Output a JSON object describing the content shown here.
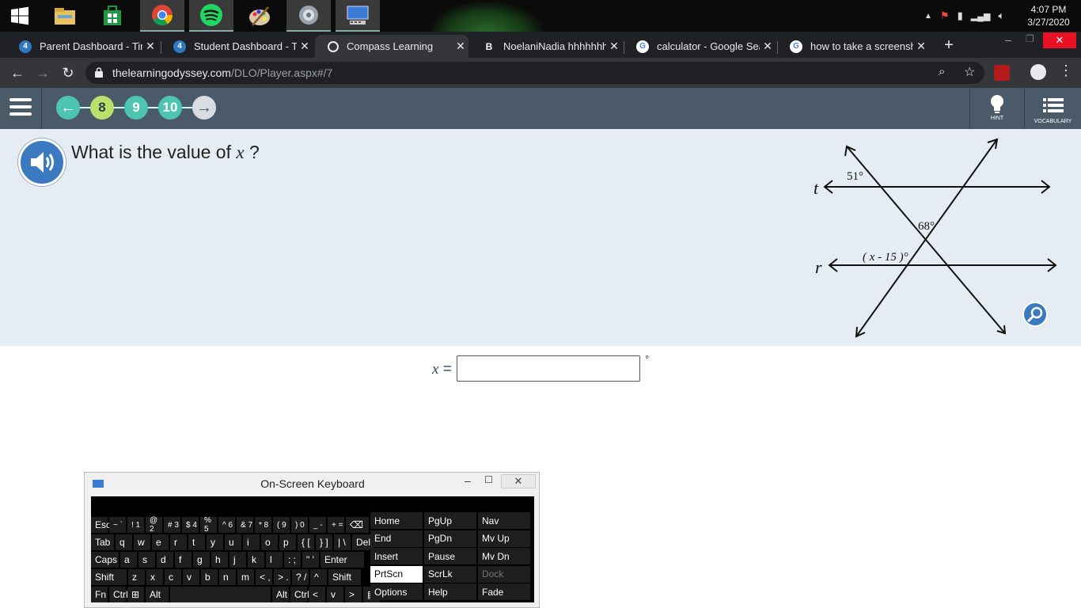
{
  "taskbar": {
    "apps": [
      "file-explorer",
      "microsoft-store",
      "chrome",
      "spotify",
      "paint",
      "volume-app",
      "on-screen-keyboard-app"
    ],
    "time": "4:07 PM",
    "date": "3/27/2020"
  },
  "tabs": [
    {
      "title": "Parent Dashboard - Time",
      "active": false
    },
    {
      "title": "Student Dashboard - Tim",
      "active": false
    },
    {
      "title": "Compass Learning",
      "active": true
    },
    {
      "title": "NoelaniNadia hhhhhhhh",
      "active": false
    },
    {
      "title": "calculator - Google Sear",
      "active": false
    },
    {
      "title": "how to take a screensho",
      "active": false
    }
  ],
  "address": {
    "url_host": "thelearningodyssey.com",
    "url_path": "/DLO/Player.aspx#/7"
  },
  "app": {
    "questions": [
      "8",
      "9",
      "10"
    ],
    "hint_label": "HINT",
    "vocab_label": "VOCABULARY"
  },
  "question": {
    "prefix": "What is the value of ",
    "var": "x",
    "suffix": " ?"
  },
  "diagram": {
    "line_t": "t",
    "line_r": "r",
    "angle_top": "51°",
    "angle_mid": "68°",
    "angle_expr": "( x - 15 )°"
  },
  "answer": {
    "label_var": "x",
    "label_eq": " =",
    "value": "",
    "unit": "°"
  },
  "osk": {
    "title": "On-Screen Keyboard",
    "rows": [
      [
        "Esc",
        "~ `",
        "! 1",
        "@ 2",
        "# 3",
        "$ 4",
        "% 5",
        "^ 6",
        "& 7",
        "* 8",
        "( 9",
        ") 0",
        "_ -",
        "+ =",
        "⌫"
      ],
      [
        "Tab",
        "q",
        "w",
        "e",
        "r",
        "t",
        "y",
        "u",
        "i",
        "o",
        "p",
        "{ [",
        "} ]",
        "| \\",
        "Del"
      ],
      [
        "Caps",
        "a",
        "s",
        "d",
        "f",
        "g",
        "h",
        "j",
        "k",
        "l",
        ": ;",
        "\" '",
        "Enter"
      ],
      [
        "Shift",
        "z",
        "x",
        "c",
        "v",
        "b",
        "n",
        "m",
        "< ,",
        "> .",
        "? /",
        "^",
        "Shift"
      ],
      [
        "Fn",
        "Ctrl",
        "⊞",
        "Alt",
        "",
        "Alt",
        "Ctrl",
        "<",
        "v",
        ">",
        "▤"
      ]
    ],
    "side": [
      [
        "Home",
        "PgUp",
        "Nav"
      ],
      [
        "End",
        "PgDn",
        "Mv Up"
      ],
      [
        "Insert",
        "Pause",
        "Mv Dn"
      ],
      [
        "PrtScn",
        "ScrLk",
        "Dock"
      ],
      [
        "Options",
        "Help",
        "Fade"
      ]
    ]
  }
}
